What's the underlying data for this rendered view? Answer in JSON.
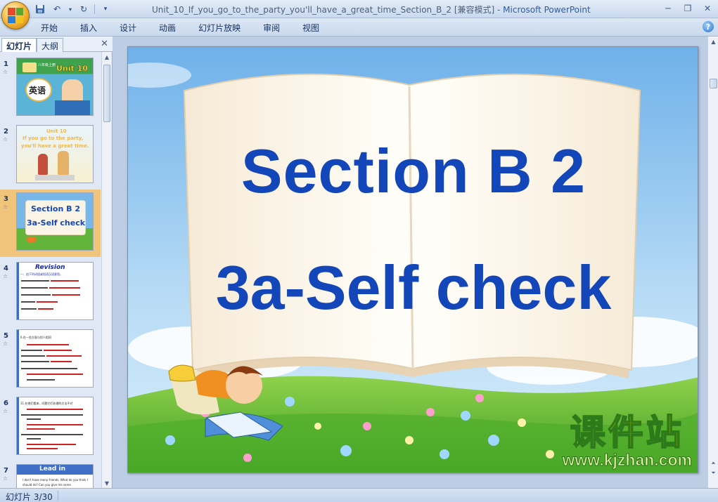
{
  "window": {
    "document_name": "Unit_10_If_you_go_to_the_party_you'll_have_a_great_time_Section_B_2 [兼容模式]",
    "separator": " - ",
    "app_name": "Microsoft PowerPoint"
  },
  "ribbon": {
    "tabs": [
      "开始",
      "插入",
      "设计",
      "动画",
      "幻灯片放映",
      "审阅",
      "视图"
    ]
  },
  "left_panel": {
    "tabs": [
      "幻灯片",
      "大纲"
    ],
    "close": "✕",
    "slides": [
      {
        "num": "1",
        "thumb_text_1": "英语",
        "thumb_text_2": "Unit 10",
        "thumb_text_3": "八年级上册"
      },
      {
        "num": "2",
        "thumb_text_1": "Unit 10",
        "thumb_text_2": "If you go to the party,",
        "thumb_text_3": "you'll have a great time."
      },
      {
        "num": "3",
        "thumb_text_1": "Section B 2",
        "thumb_text_2": "3a-Self check"
      },
      {
        "num": "4",
        "thumb_text_1": "Revision",
        "thumb_text_2": "一、由下列词组或短语汉语意思。"
      },
      {
        "num": "5",
        "thumb_text_1": "6.在一些方面与别人相同"
      },
      {
        "num": "6",
        "thumb_text_1": "11.在他们看来，问题它们处理的方法不对"
      },
      {
        "num": "7",
        "thumb_text_1": "Lead in",
        "thumb_text_2": "I don't have many friends. What do you think I should do? Can you give me some"
      }
    ],
    "selected_index": 2
  },
  "slide": {
    "title_line1": "Section B 2",
    "title_line2": "3a-Self check",
    "watermark_cn": "课件站",
    "watermark_url": "www.kjzhan.com"
  },
  "statusbar": {
    "slide_info": "幻灯片 3/30"
  },
  "colors": {
    "title_blue": "#1346b8",
    "sky": "#79b6ea",
    "grass": "#5db02f",
    "selected_thumb": "#f1c47c"
  }
}
